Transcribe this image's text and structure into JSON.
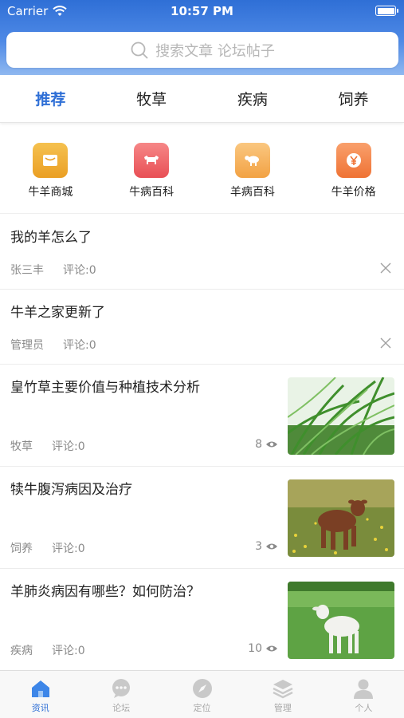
{
  "status": {
    "carrier": "Carrier",
    "time": "10:57 PM"
  },
  "search": {
    "placeholder": "搜索文章 论坛帖子"
  },
  "tabs": [
    {
      "label": "推荐",
      "active": true
    },
    {
      "label": "牧草",
      "active": false
    },
    {
      "label": "疾病",
      "active": false
    },
    {
      "label": "饲养",
      "active": false
    }
  ],
  "quick": [
    {
      "label": "牛羊商城",
      "icon": "mail-icon",
      "color": "#f0b23a"
    },
    {
      "label": "牛病百科",
      "icon": "cow-icon",
      "color": "#f06a6a"
    },
    {
      "label": "羊病百科",
      "icon": "sheep-icon",
      "color": "#f7b760"
    },
    {
      "label": "牛羊价格",
      "icon": "yen-icon",
      "color": "#f68a55"
    }
  ],
  "posts": [
    {
      "title": "我的羊怎么了",
      "author": "张三丰",
      "comments": "评论:0"
    },
    {
      "title": "牛羊之家更新了",
      "author": "管理员",
      "comments": "评论:0"
    },
    {
      "title": "皇竹草主要价值与种植技术分析",
      "category": "牧草",
      "comments": "评论:0",
      "views": "8",
      "thumb": "grass-photo"
    },
    {
      "title": "犊牛腹泻病因及治疗",
      "category": "饲养",
      "comments": "评论:0",
      "views": "3",
      "thumb": "calf-photo"
    },
    {
      "title": "羊肺炎病因有哪些？如何防治？",
      "category": "疾病",
      "comments": "评论:0",
      "views": "10",
      "thumb": "lamb-photo"
    }
  ],
  "tabbar": [
    {
      "label": "资讯",
      "icon": "home-icon",
      "active": true
    },
    {
      "label": "论坛",
      "icon": "chat-icon",
      "active": false
    },
    {
      "label": "定位",
      "icon": "compass-icon",
      "active": false
    },
    {
      "label": "管理",
      "icon": "layers-icon",
      "active": false
    },
    {
      "label": "个人",
      "icon": "person-icon",
      "active": false
    }
  ],
  "colors": {
    "accent": "#2f6fd6",
    "header_top": "#2f6fd6",
    "header_bottom": "#8fb8f0"
  }
}
